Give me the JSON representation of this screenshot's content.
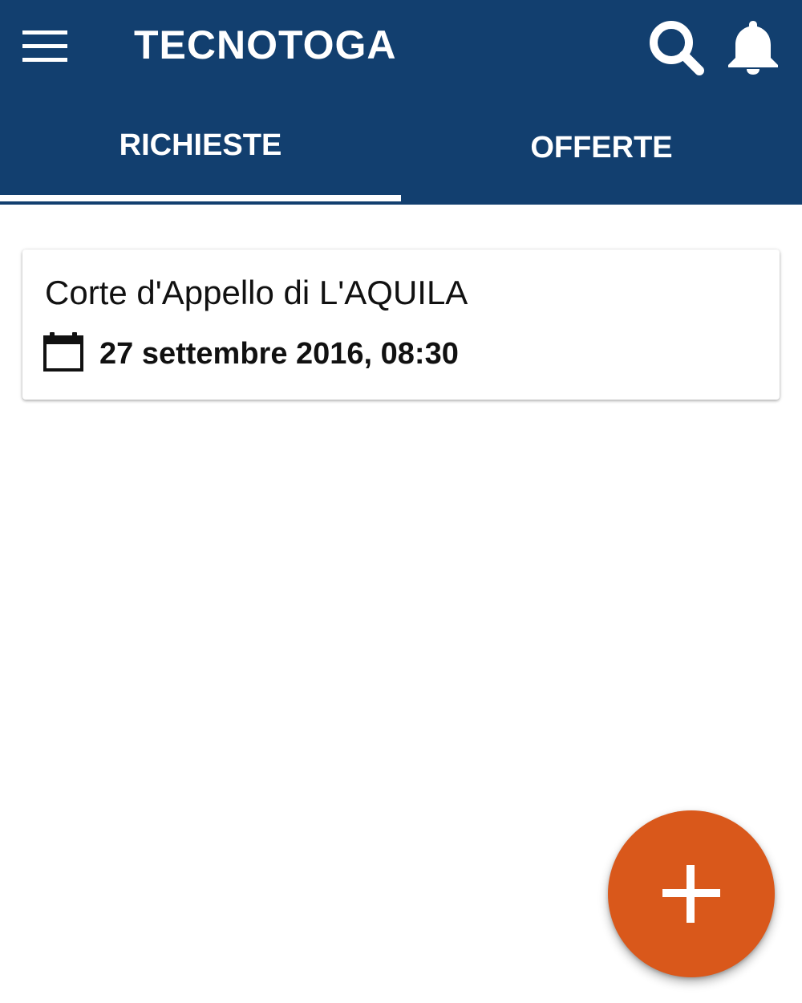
{
  "app_bar": {
    "title": "TECNOTOGA",
    "background_color": "#123f6f",
    "menu_icon": "hamburger-menu-icon",
    "search_icon": "search-icon",
    "notifications_icon": "bell-icon"
  },
  "tabs": [
    {
      "label": "RICHIESTE",
      "selected": true
    },
    {
      "label": "OFFERTE",
      "selected": false
    }
  ],
  "requests": [
    {
      "title": "Corte d'Appello di L'AQUILA",
      "date_icon": "calendar-icon",
      "date": "27 settembre 2016, 08:30"
    }
  ],
  "fab": {
    "icon": "plus-icon",
    "color": "#d9581b"
  }
}
